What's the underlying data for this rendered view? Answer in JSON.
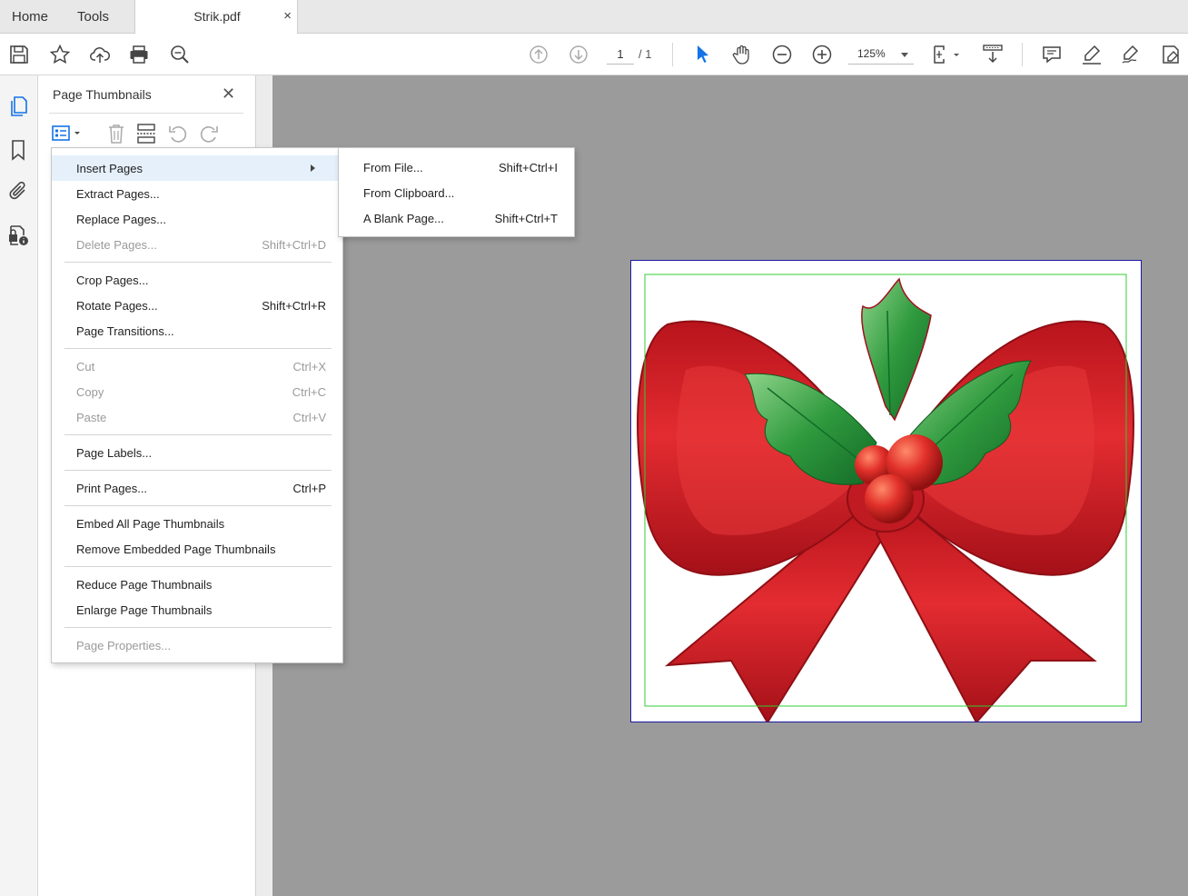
{
  "tabs": {
    "home": "Home",
    "tools": "Tools",
    "document": {
      "title": "Strik.pdf",
      "close": "×"
    }
  },
  "toolbar": {
    "icons": [
      "save-icon",
      "star-icon",
      "cloud-upload-icon",
      "print-icon",
      "zoom-search-icon",
      "prev-page-icon",
      "next-page-icon",
      "select-cursor-icon",
      "hand-icon",
      "zoom-out-icon",
      "zoom-in-icon",
      "page-fit-icon",
      "scroll-mode-icon",
      "comment-icon",
      "highlight-icon",
      "sign-icon",
      "fill-sign-icon"
    ],
    "page_current": "1",
    "page_total": "/ 1",
    "zoom": "125%",
    "accent": "#1473e6"
  },
  "rail": {
    "icons": [
      "pages-icon",
      "bookmark-icon",
      "attachment-icon",
      "security-icon"
    ]
  },
  "panel": {
    "title": "Page Thumbnails",
    "close": "✕",
    "tools": [
      "options-icon",
      "delete-icon",
      "insert-icon",
      "rotate-left-icon",
      "rotate-right-icon"
    ]
  },
  "context_menu": {
    "groups": [
      [
        {
          "label": "Insert Pages",
          "shortcut": "",
          "submenu": true,
          "highlighted": true
        },
        {
          "label": "Extract Pages...",
          "shortcut": ""
        },
        {
          "label": "Replace Pages...",
          "shortcut": ""
        },
        {
          "label": "Delete Pages...",
          "shortcut": "Shift+Ctrl+D",
          "disabled": true
        }
      ],
      [
        {
          "label": "Crop Pages...",
          "shortcut": ""
        },
        {
          "label": "Rotate Pages...",
          "shortcut": "Shift+Ctrl+R"
        },
        {
          "label": "Page Transitions...",
          "shortcut": ""
        }
      ],
      [
        {
          "label": "Cut",
          "shortcut": "Ctrl+X",
          "disabled": true
        },
        {
          "label": "Copy",
          "shortcut": "Ctrl+C",
          "disabled": true
        },
        {
          "label": "Paste",
          "shortcut": "Ctrl+V",
          "disabled": true
        }
      ],
      [
        {
          "label": "Page Labels...",
          "shortcut": ""
        }
      ],
      [
        {
          "label": "Print Pages...",
          "shortcut": "Ctrl+P"
        }
      ],
      [
        {
          "label": "Embed All Page Thumbnails",
          "shortcut": ""
        },
        {
          "label": "Remove Embedded Page Thumbnails",
          "shortcut": ""
        }
      ],
      [
        {
          "label": "Reduce Page Thumbnails",
          "shortcut": ""
        },
        {
          "label": "Enlarge Page Thumbnails",
          "shortcut": ""
        }
      ],
      [
        {
          "label": "Page Properties...",
          "shortcut": "",
          "disabled": true
        }
      ]
    ]
  },
  "submenu": {
    "items": [
      {
        "label": "From File...",
        "shortcut": "Shift+Ctrl+I"
      },
      {
        "label": "From Clipboard...",
        "shortcut": ""
      },
      {
        "label": "A Blank Page...",
        "shortcut": "Shift+Ctrl+T"
      }
    ]
  },
  "document": {
    "image": "christmas-bow-with-holly-image",
    "colors": {
      "ribbon": "#d8232a",
      "holly": "#2f9a3e",
      "crop_box": "#33cc33",
      "page_border": "#1a1aa0"
    }
  }
}
